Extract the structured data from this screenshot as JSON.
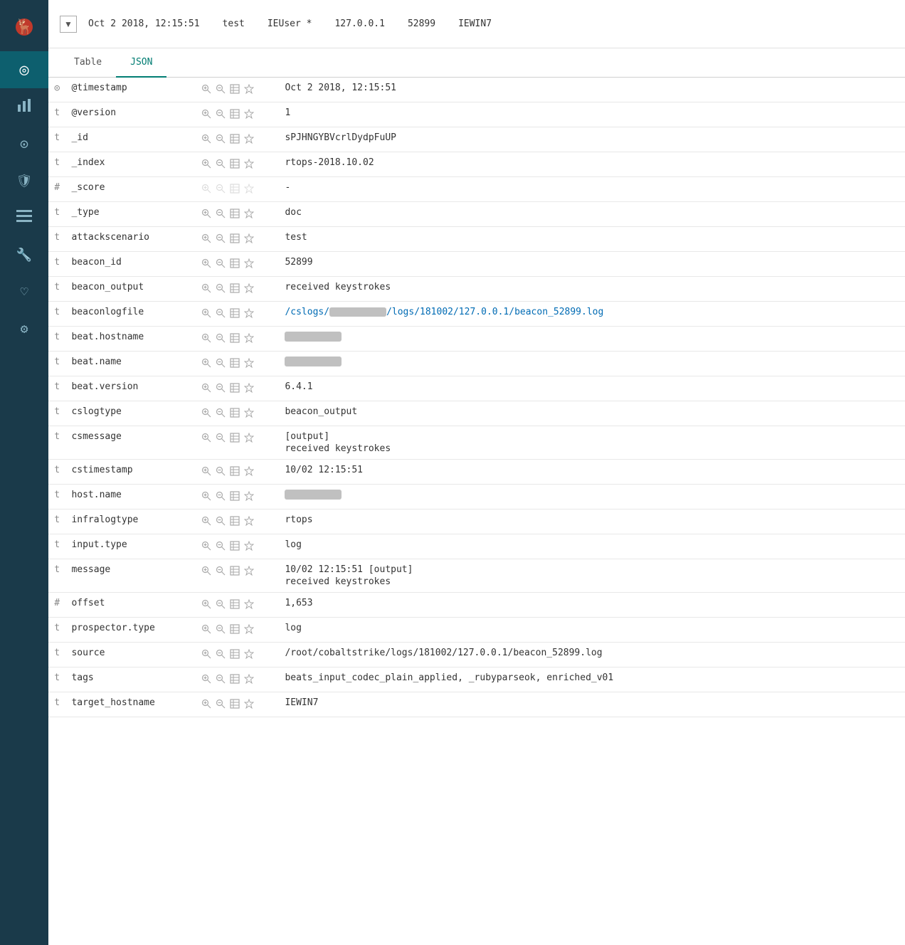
{
  "sidebar": {
    "logo": "🦌",
    "items": [
      {
        "id": "discover",
        "icon": "◎",
        "active": true
      },
      {
        "id": "visualize",
        "icon": "📊"
      },
      {
        "id": "dashboard",
        "icon": "⊙"
      },
      {
        "id": "timelion",
        "icon": "🛡"
      },
      {
        "id": "management",
        "icon": "≡"
      },
      {
        "id": "dev-tools",
        "icon": "🔧"
      },
      {
        "id": "monitoring",
        "icon": "♡"
      },
      {
        "id": "settings",
        "icon": "⚙"
      }
    ]
  },
  "topbar": {
    "toggle_label": "▼",
    "timestamp": "Oct 2 2018, 12:15:51",
    "scenario": "test",
    "user": "IEUser *",
    "ip": "127.0.0.1",
    "beacon_id": "52899",
    "hostname": "IEWIN7"
  },
  "tabs": [
    {
      "id": "table",
      "label": "Table",
      "active": false
    },
    {
      "id": "json",
      "label": "JSON",
      "active": true
    }
  ],
  "rows": [
    {
      "type": "⊙",
      "field": "@timestamp",
      "value": "Oct 2 2018, 12:15:51",
      "link": false,
      "blurred": false,
      "multiline": false
    },
    {
      "type": "t",
      "field": "@version",
      "value": "1",
      "link": false,
      "blurred": false,
      "multiline": false
    },
    {
      "type": "t",
      "field": "_id",
      "value": "sPJHNGYBVcrlDydpFuUP",
      "link": false,
      "blurred": false,
      "multiline": false
    },
    {
      "type": "t",
      "field": "_index",
      "value": "rtops-2018.10.02",
      "link": false,
      "blurred": false,
      "multiline": false
    },
    {
      "type": "#",
      "field": "_score",
      "value": "-",
      "link": false,
      "blurred": false,
      "multiline": false,
      "disabled": true
    },
    {
      "type": "t",
      "field": "_type",
      "value": "doc",
      "link": false,
      "blurred": false,
      "multiline": false
    },
    {
      "type": "t",
      "field": "attackscenario",
      "value": "test",
      "link": false,
      "blurred": false,
      "multiline": false
    },
    {
      "type": "t",
      "field": "beacon_id",
      "value": "52899",
      "link": false,
      "blurred": false,
      "multiline": false
    },
    {
      "type": "t",
      "field": "beacon_output",
      "value": "received keystrokes",
      "link": false,
      "blurred": false,
      "multiline": false
    },
    {
      "type": "t",
      "field": "beaconlogfile",
      "value": "/cslogs/█████/logs/181002/127.0.0.1/beacon_52899.log",
      "link": true,
      "blurred": false,
      "multiline": false,
      "link_prefix": "/cslogs/",
      "link_suffix": "/logs/181002/127.0.0.1/beacon_52899.log"
    },
    {
      "type": "t",
      "field": "beat.hostname",
      "value": "",
      "link": false,
      "blurred": true,
      "multiline": false
    },
    {
      "type": "t",
      "field": "beat.name",
      "value": "",
      "link": false,
      "blurred": true,
      "multiline": false
    },
    {
      "type": "t",
      "field": "beat.version",
      "value": "6.4.1",
      "link": false,
      "blurred": false,
      "multiline": false
    },
    {
      "type": "t",
      "field": "cslogtype",
      "value": "beacon_output",
      "link": false,
      "blurred": false,
      "multiline": false
    },
    {
      "type": "t",
      "field": "csmessage",
      "value": "[output]\nreceived keystrokes",
      "link": false,
      "blurred": false,
      "multiline": true
    },
    {
      "type": "t",
      "field": "cstimestamp",
      "value": "10/02 12:15:51",
      "link": false,
      "blurred": false,
      "multiline": false
    },
    {
      "type": "t",
      "field": "host.name",
      "value": "",
      "link": false,
      "blurred": true,
      "multiline": false
    },
    {
      "type": "t",
      "field": "infralogtype",
      "value": "rtops",
      "link": false,
      "blurred": false,
      "multiline": false
    },
    {
      "type": "t",
      "field": "input.type",
      "value": "log",
      "link": false,
      "blurred": false,
      "multiline": false
    },
    {
      "type": "t",
      "field": "message",
      "value": "10/02 12:15:51 [output]\nreceived keystrokes",
      "link": false,
      "blurred": false,
      "multiline": true
    },
    {
      "type": "#",
      "field": "offset",
      "value": "1,653",
      "link": false,
      "blurred": false,
      "multiline": false
    },
    {
      "type": "t",
      "field": "prospector.type",
      "value": "log",
      "link": false,
      "blurred": false,
      "multiline": false
    },
    {
      "type": "t",
      "field": "source",
      "value": "/root/cobaltstrike/logs/181002/127.0.0.1/beacon_52899.log",
      "link": false,
      "blurred": false,
      "multiline": false
    },
    {
      "type": "t",
      "field": "tags",
      "value": "beats_input_codec_plain_applied, _rubyparseok, enriched_v01",
      "link": false,
      "blurred": false,
      "multiline": false
    },
    {
      "type": "t",
      "field": "target_hostname",
      "value": "IEWIN7",
      "link": false,
      "blurred": false,
      "multiline": false
    }
  ]
}
